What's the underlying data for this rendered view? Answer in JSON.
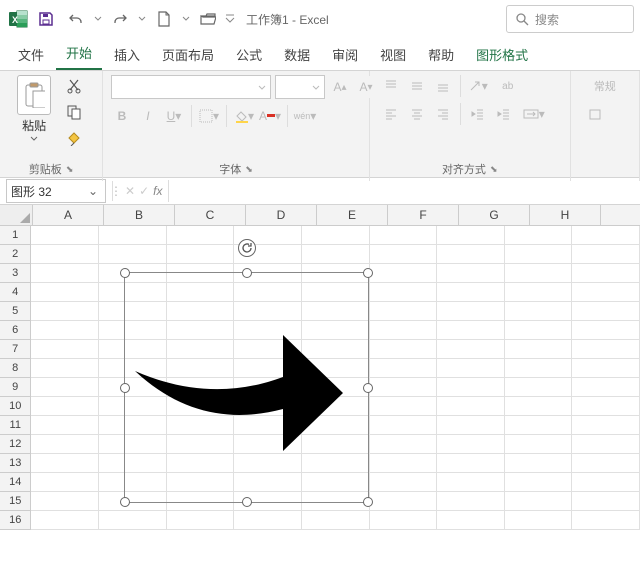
{
  "titlebar": {
    "doc_title": "工作簿1 - Excel",
    "search_placeholder": "搜索"
  },
  "tabs": {
    "file": "文件",
    "home": "开始",
    "insert": "插入",
    "layout": "页面布局",
    "formulas": "公式",
    "data": "数据",
    "review": "审阅",
    "view": "视图",
    "help": "帮助",
    "shape_format": "图形格式"
  },
  "ribbon": {
    "clipboard": {
      "paste": "粘贴",
      "group": "剪贴板"
    },
    "font": {
      "group": "字体",
      "wen": "wén"
    },
    "align": {
      "group": "对齐方式",
      "wrap": "ab"
    },
    "style": {
      "group": "常规"
    }
  },
  "namebox": {
    "value": "图形 32",
    "fx": "fx"
  },
  "columns": [
    "A",
    "B",
    "C",
    "D",
    "E",
    "F",
    "G",
    "H"
  ],
  "rows": [
    "1",
    "2",
    "3",
    "4",
    "5",
    "6",
    "7",
    "8",
    "9",
    "10",
    "11",
    "12",
    "13",
    "14",
    "15",
    "16"
  ]
}
